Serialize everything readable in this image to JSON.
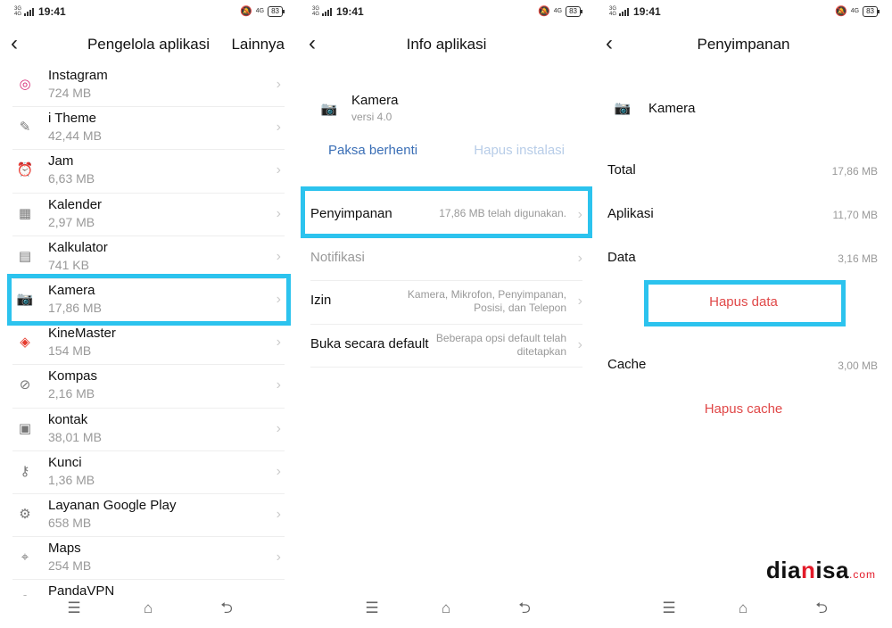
{
  "status": {
    "network": "3G",
    "network2": "4G",
    "time": "19:41",
    "lte": "4G",
    "battery": "83"
  },
  "panel1": {
    "title": "Pengelola aplikasi",
    "more": "Lainnya",
    "apps": [
      {
        "name": "Instagram",
        "size": "724 MB",
        "icon": "instagram-icon"
      },
      {
        "name": "i Theme",
        "size": "42,44 MB",
        "icon": "theme-icon"
      },
      {
        "name": "Jam",
        "size": "6,63 MB",
        "icon": "alarm-clock-icon"
      },
      {
        "name": "Kalender",
        "size": "2,97 MB",
        "icon": "calendar-icon"
      },
      {
        "name": "Kalkulator",
        "size": "741 KB",
        "icon": "calculator-icon"
      },
      {
        "name": "Kamera",
        "size": "17,86 MB",
        "icon": "camera-icon"
      },
      {
        "name": "KineMaster",
        "size": "154 MB",
        "icon": "kinemaster-icon"
      },
      {
        "name": "Kompas",
        "size": "2,16 MB",
        "icon": "compass-icon"
      },
      {
        "name": "kontak",
        "size": "38,01 MB",
        "icon": "contacts-icon"
      },
      {
        "name": "Kunci",
        "size": "1,36 MB",
        "icon": "lock-icon"
      },
      {
        "name": "Layanan Google Play",
        "size": "658 MB",
        "icon": "gear-icon"
      },
      {
        "name": "Maps",
        "size": "254 MB",
        "icon": "maps-icon"
      },
      {
        "name": "PandaVPN",
        "size": "",
        "icon": "vpn-icon"
      }
    ]
  },
  "panel2": {
    "title": "Info aplikasi",
    "app_name": "Kamera",
    "app_version": "versi 4.0",
    "force_stop": "Paksa berhenti",
    "uninstall": "Hapus instalasi",
    "items": [
      {
        "label": "Penyimpanan",
        "value": "17,86 MB telah digunakan."
      },
      {
        "label": "Notifikasi",
        "value": ""
      },
      {
        "label": "Izin",
        "value": "Kamera, Mikrofon, Penyimpanan, Posisi, dan Telepon"
      },
      {
        "label": "Buka secara default",
        "value": "Beberapa opsi default telah ditetapkan"
      }
    ]
  },
  "panel3": {
    "title": "Penyimpanan",
    "app_name": "Kamera",
    "total_label": "Total",
    "total_value": "17,86 MB",
    "app_label": "Aplikasi",
    "app_value": "11,70 MB",
    "data_label": "Data",
    "data_value": "3,16 MB",
    "clear_data": "Hapus data",
    "cache_label": "Cache",
    "cache_value": "3,00 MB",
    "clear_cache": "Hapus cache"
  },
  "watermark": {
    "part1": "dia",
    "part2": "n",
    "part3": "isa",
    "suffix": ".com"
  },
  "colors": {
    "highlight": "#2cc3ee",
    "link_blue": "#3b6fb6",
    "danger_red": "#e04848"
  }
}
